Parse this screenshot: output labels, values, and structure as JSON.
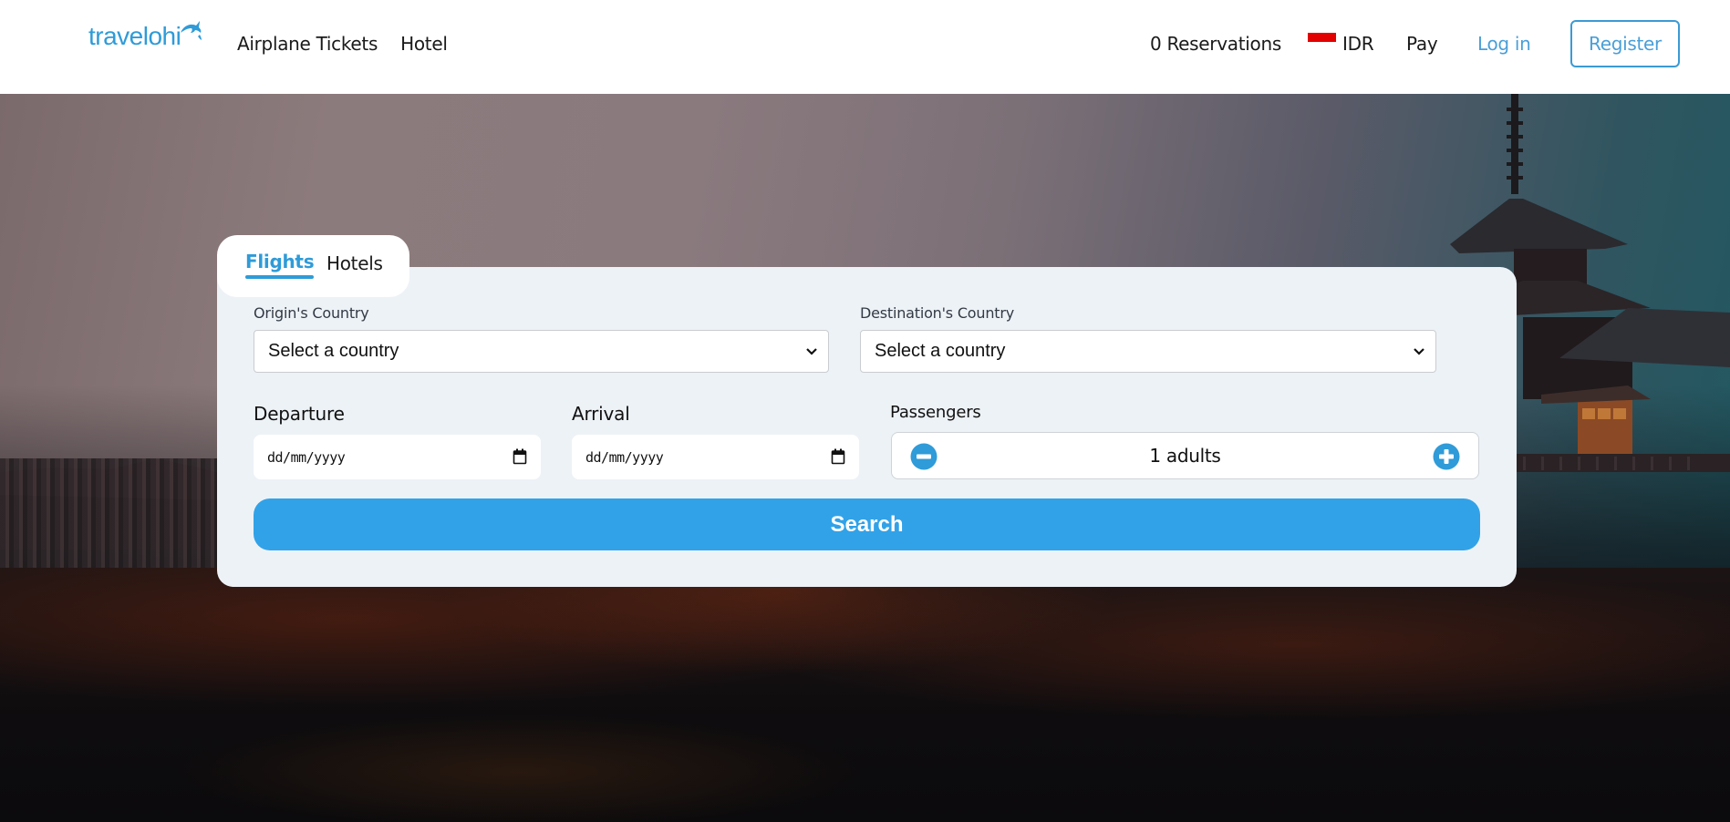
{
  "header": {
    "logo_text": "travelohi",
    "nav": [
      {
        "label": "Airplane Tickets"
      },
      {
        "label": "Hotel"
      }
    ],
    "reservations_label": "0 Reservations",
    "currency": {
      "code": "IDR",
      "flag": "indonesia-flag"
    },
    "pay_label": "Pay",
    "login_label": "Log in",
    "register_label": "Register"
  },
  "search": {
    "tabs": [
      {
        "label": "Flights",
        "active": true
      },
      {
        "label": "Hotels",
        "active": false
      }
    ],
    "origin": {
      "label": "Origin's Country",
      "value": "Select a country"
    },
    "destination": {
      "label": "Destination's Country",
      "value": "Select a country"
    },
    "departure": {
      "label": "Departure",
      "placeholder": "dd/mm/yyyy"
    },
    "arrival": {
      "label": "Arrival",
      "placeholder": "dd/mm/yyyy"
    },
    "passengers": {
      "label": "Passengers",
      "value": "1 adults"
    },
    "search_button_label": "Search"
  },
  "colors": {
    "accent": "#2f9bd8",
    "search_button": "#31a2e8",
    "card_bg": "#edf2f7",
    "flag_red": "#e30000"
  }
}
